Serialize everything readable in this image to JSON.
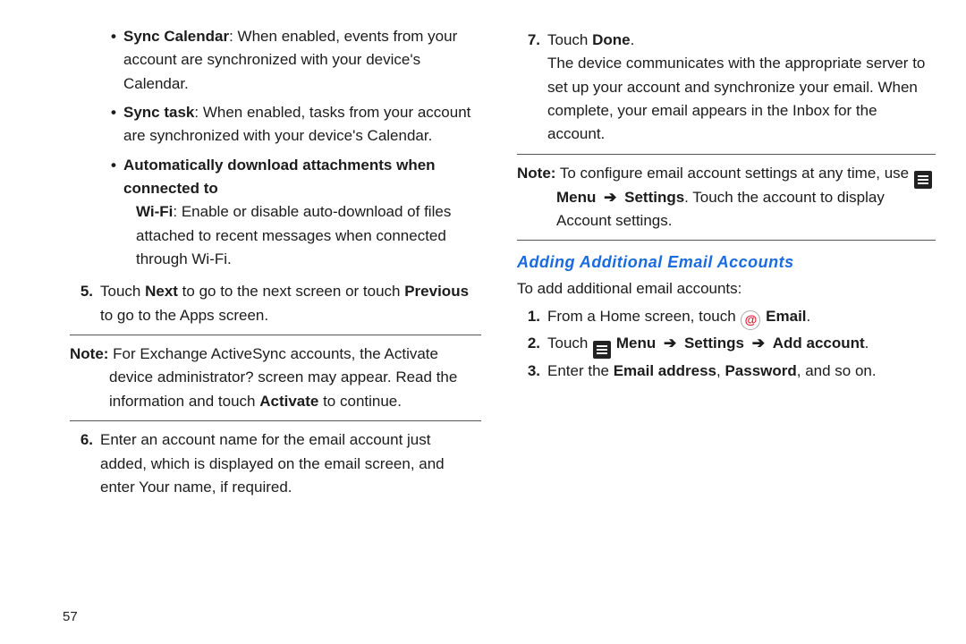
{
  "left": {
    "bullets": [
      {
        "title": "Sync Calendar",
        "body": ": When enabled, events from your account are synchronized with your device's Calendar."
      },
      {
        "title": "Sync task",
        "body": ": When enabled, tasks from your account are synchronized with your device's Calendar."
      },
      {
        "title": "Automatically download attachments when connected to Wi-Fi",
        "body": ": Enable or disable auto-download of files attached to recent messages when connected through Wi-Fi."
      }
    ],
    "step5": {
      "num": "5.",
      "pre": "Touch ",
      "next": "Next",
      "mid": " to go to the next screen or touch ",
      "prev": "Previous",
      "post": " to go to the Apps screen."
    },
    "note1": {
      "label": "Note:",
      "body": " For Exchange ActiveSync accounts, the Activate device administrator? screen may appear. Read the information and touch ",
      "activate": "Activate",
      "post": " to continue."
    },
    "step6": {
      "num": "6.",
      "body": "Enter an account name for the email account just added, which is displayed on the email screen, and enter Your name, if required."
    }
  },
  "right": {
    "step7": {
      "num": "7.",
      "line1_pre": "Touch ",
      "done": "Done",
      "line1_post": ".",
      "body": "The device communicates with the appropriate server to set up your account and synchronize your email. When complete, your email appears in the Inbox for the account."
    },
    "note2": {
      "label": "Note:",
      "pre": " To configure email account settings at any time, use ",
      "menu": "Menu",
      "arrow": "➔",
      "settings": "Settings",
      "post1": ". Touch the account to display Account settings."
    },
    "section_heading": "Adding Additional Email Accounts",
    "intro": "To add additional email accounts:",
    "s1": {
      "num": "1.",
      "pre": "From a Home screen, touch ",
      "email": "Email",
      "post": "."
    },
    "s2": {
      "num": "2.",
      "pre": "Touch ",
      "menu": "Menu",
      "arrow": "➔",
      "settings": "Settings",
      "add": "Add account",
      "post": "."
    },
    "s3": {
      "num": "3.",
      "pre": "Enter the ",
      "ea": "Email address",
      "comma": ", ",
      "pw": "Password",
      "post": ", and so on."
    }
  },
  "page_number": "57"
}
